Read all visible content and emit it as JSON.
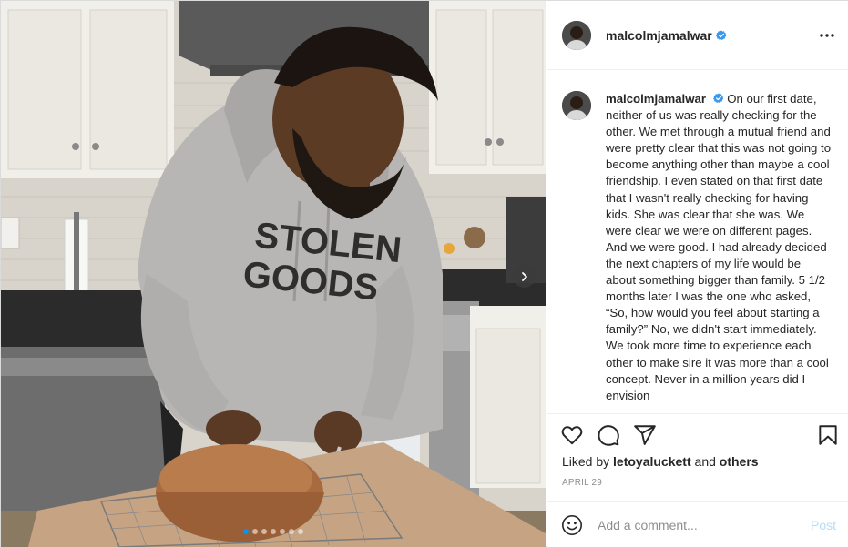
{
  "post": {
    "author": {
      "username": "malcolmjamalwar",
      "verified": true,
      "avatar_icon": "profile-photo"
    },
    "caption": "On our first date, neither of us was really checking for the other. We met through a mutual friend and were pretty clear that this was not going to become anything other than maybe a cool friendship. I even stated on that first date that I wasn't really checking for having kids. She was clear that she was. We were clear we were on different pages. And we were good. I had already decided the next chapters of my life would be about something bigger than family. 5 1/2 months later I was the one who asked, “So, how would you feel about starting a family?” No, we didn't start immediately. We took more time to experience each other to make sire it was more than a cool concept. Never in a million years did I envision",
    "photo": {
      "hoodie_text_line1": "STOLEN",
      "hoodie_text_line2": "GOODS",
      "carousel_dots": 7,
      "active_dot": 0
    },
    "likes": {
      "prefix": "Liked by",
      "user": "letoyaluckett",
      "connector": "and",
      "suffix": "others"
    },
    "date": "APRIL 29",
    "comment": {
      "placeholder": "Add a comment...",
      "post_label": "Post"
    },
    "icons": {
      "like": "heart-icon",
      "comment": "comment-icon",
      "share": "share-icon",
      "save": "bookmark-icon",
      "more": "more-options-icon",
      "emoji": "emoji-icon",
      "next": "chevron-right-icon"
    },
    "colors": {
      "verified": "#3897f0",
      "post_button_disabled": "#b2dffc",
      "secondary_text": "#8e8e8e",
      "border": "#efefef"
    }
  }
}
